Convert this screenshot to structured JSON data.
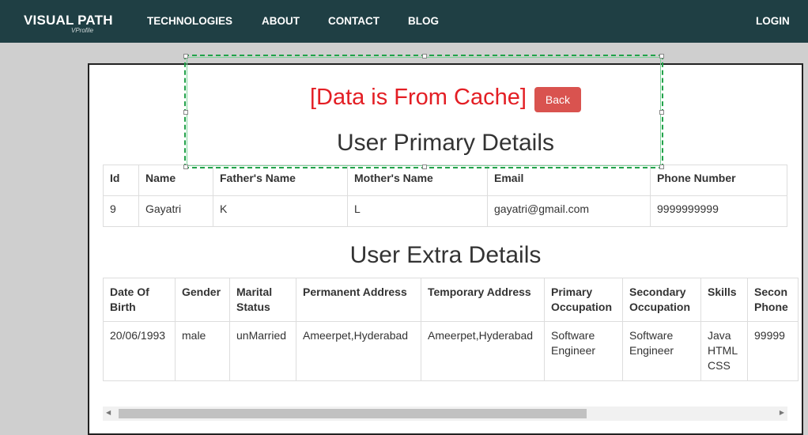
{
  "navbar": {
    "brand": "VISUAL PATH",
    "brand_sub": "VProfile",
    "links": [
      "TECHNOLOGIES",
      "ABOUT",
      "CONTACT",
      "BLOG"
    ],
    "login": "LOGIN"
  },
  "cache_notice": "[Data is From Cache]",
  "back_button": "Back",
  "primary": {
    "title": "User Primary Details",
    "headers": [
      "Id",
      "Name",
      "Father's Name",
      "Mother's Name",
      "Email",
      "Phone Number"
    ],
    "row": [
      "9",
      "Gayatri",
      "K",
      "L",
      "gayatri@gmail.com",
      "9999999999"
    ]
  },
  "extra": {
    "title": "User Extra Details",
    "headers": [
      "Date Of Birth",
      "Gender",
      "Marital Status",
      "Permanent Address",
      "Temporary Address",
      "Primary Occupation",
      "Secondary Occupation",
      "Skills",
      "Secon Phone"
    ],
    "row": [
      "20/06/1993",
      "male",
      "unMarried",
      "Ameerpet,Hyderabad",
      "Ameerpet,Hyderabad",
      "Software Engineer",
      "Software Engineer",
      "Java HTML CSS",
      "99999"
    ]
  },
  "colors": {
    "navbar": "#1f3f44",
    "alert_text": "#e31e24",
    "back_button": "#d9534f",
    "selection": "#22a24a"
  }
}
